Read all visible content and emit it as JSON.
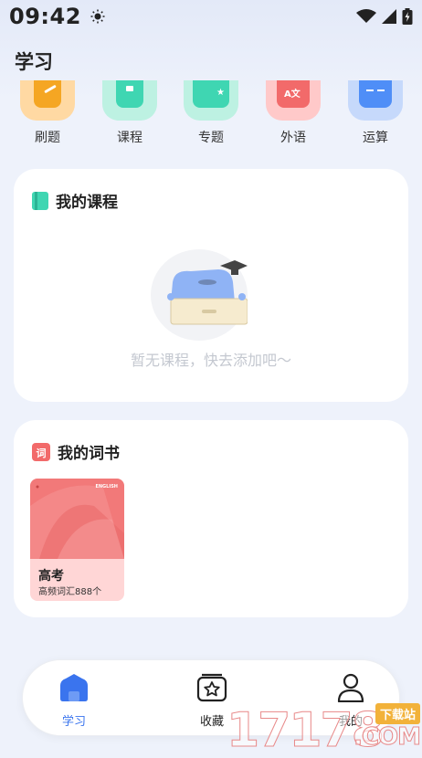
{
  "status_bar": {
    "time": "09:42"
  },
  "header": {
    "title": "学习"
  },
  "shortcuts": [
    {
      "label": "刷题",
      "icon": "pencil-book-icon",
      "color": "#f5a623"
    },
    {
      "label": "课程",
      "icon": "course-icon",
      "color": "#3fd6b2"
    },
    {
      "label": "专题",
      "icon": "topic-star-icon",
      "color": "#3fd6b2"
    },
    {
      "label": "外语",
      "icon": "language-bubble-icon",
      "color": "#f26a6a"
    },
    {
      "label": "运算",
      "icon": "calculator-icon",
      "color": "#4f8ef7"
    }
  ],
  "my_courses": {
    "title": "我的课程",
    "empty_text": "暂无课程，快去添加吧～"
  },
  "my_books": {
    "title": "我的词书",
    "books": [
      {
        "title": "高考",
        "subtitle": "高频词汇888个",
        "cover_tag": "ENGLISH"
      }
    ]
  },
  "bottom_nav": {
    "items": [
      {
        "label": "学习",
        "icon": "home-icon",
        "active": true
      },
      {
        "label": "收藏",
        "icon": "star-folder-icon",
        "active": false
      },
      {
        "label": "我的",
        "icon": "user-icon",
        "active": false
      }
    ]
  },
  "watermark": {
    "digits": "17178",
    "badge": "下载站",
    "suffix": ".COM"
  },
  "colors": {
    "accent": "#3a74ee",
    "background": "#eef2fb",
    "card": "#ffffff"
  }
}
